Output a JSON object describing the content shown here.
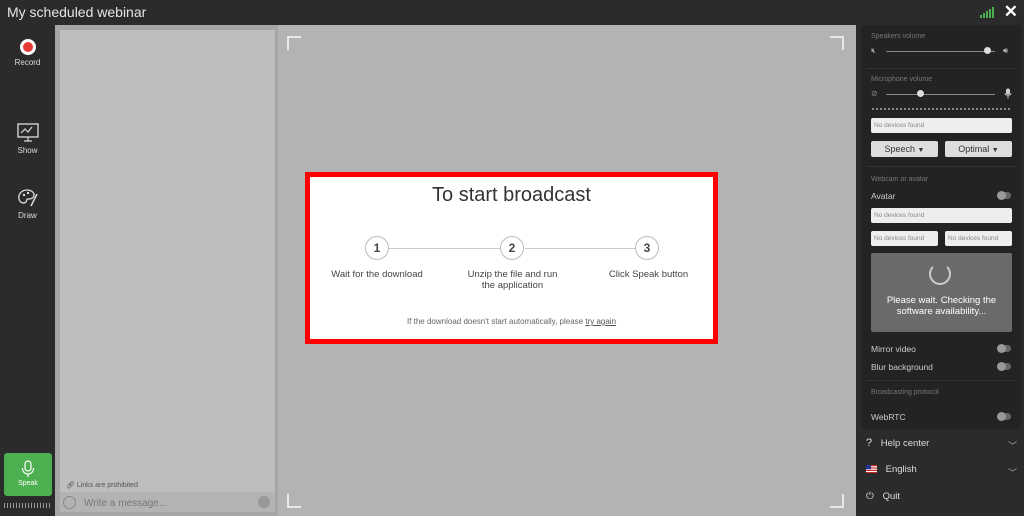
{
  "window": {
    "title": "My scheduled webinar"
  },
  "colors": {
    "accent_green": "#4caf50",
    "record_red": "#e53935",
    "dialog_border": "#ff0000"
  },
  "left_toolbar": {
    "record_label": "Record",
    "show_label": "Show",
    "draw_label": "Draw",
    "speak_label": "Speak"
  },
  "chat": {
    "links_notice": "Links are prohibited",
    "message_placeholder": "Write a message..."
  },
  "dialog": {
    "title": "To start broadcast",
    "steps": [
      {
        "number": "1",
        "label": "Wait for the download"
      },
      {
        "number": "2",
        "label": "Unzip the file and run the application"
      },
      {
        "number": "3",
        "label": "Click Speak button"
      }
    ],
    "hint_prefix": "If the download doesn't start automatically, please",
    "hint_link": "try again"
  },
  "settings": {
    "speakers_volume_label": "Speakers volume",
    "speakers_volume": 0.93,
    "microphone_volume_label": "Microphone volume",
    "microphone_volume": 0.32,
    "mic_device": "No devices found",
    "speech_mode": "Speech",
    "quality": "Optimal",
    "webcam_label": "Webcam or avatar",
    "avatar_label": "Avatar",
    "webcam_device": "No devices found",
    "resolution_device": "No devices found",
    "fps_device": "No devices found",
    "please_wait": "Please wait. Checking the software availability...",
    "mirror_label": "Mirror video",
    "blur_label": "Blur background",
    "protocol_label": "Broadcasting protocol",
    "protocol_value": "WebRTC"
  },
  "bottom_menu": {
    "help": "Help center",
    "language": "English",
    "quit": "Quit"
  }
}
